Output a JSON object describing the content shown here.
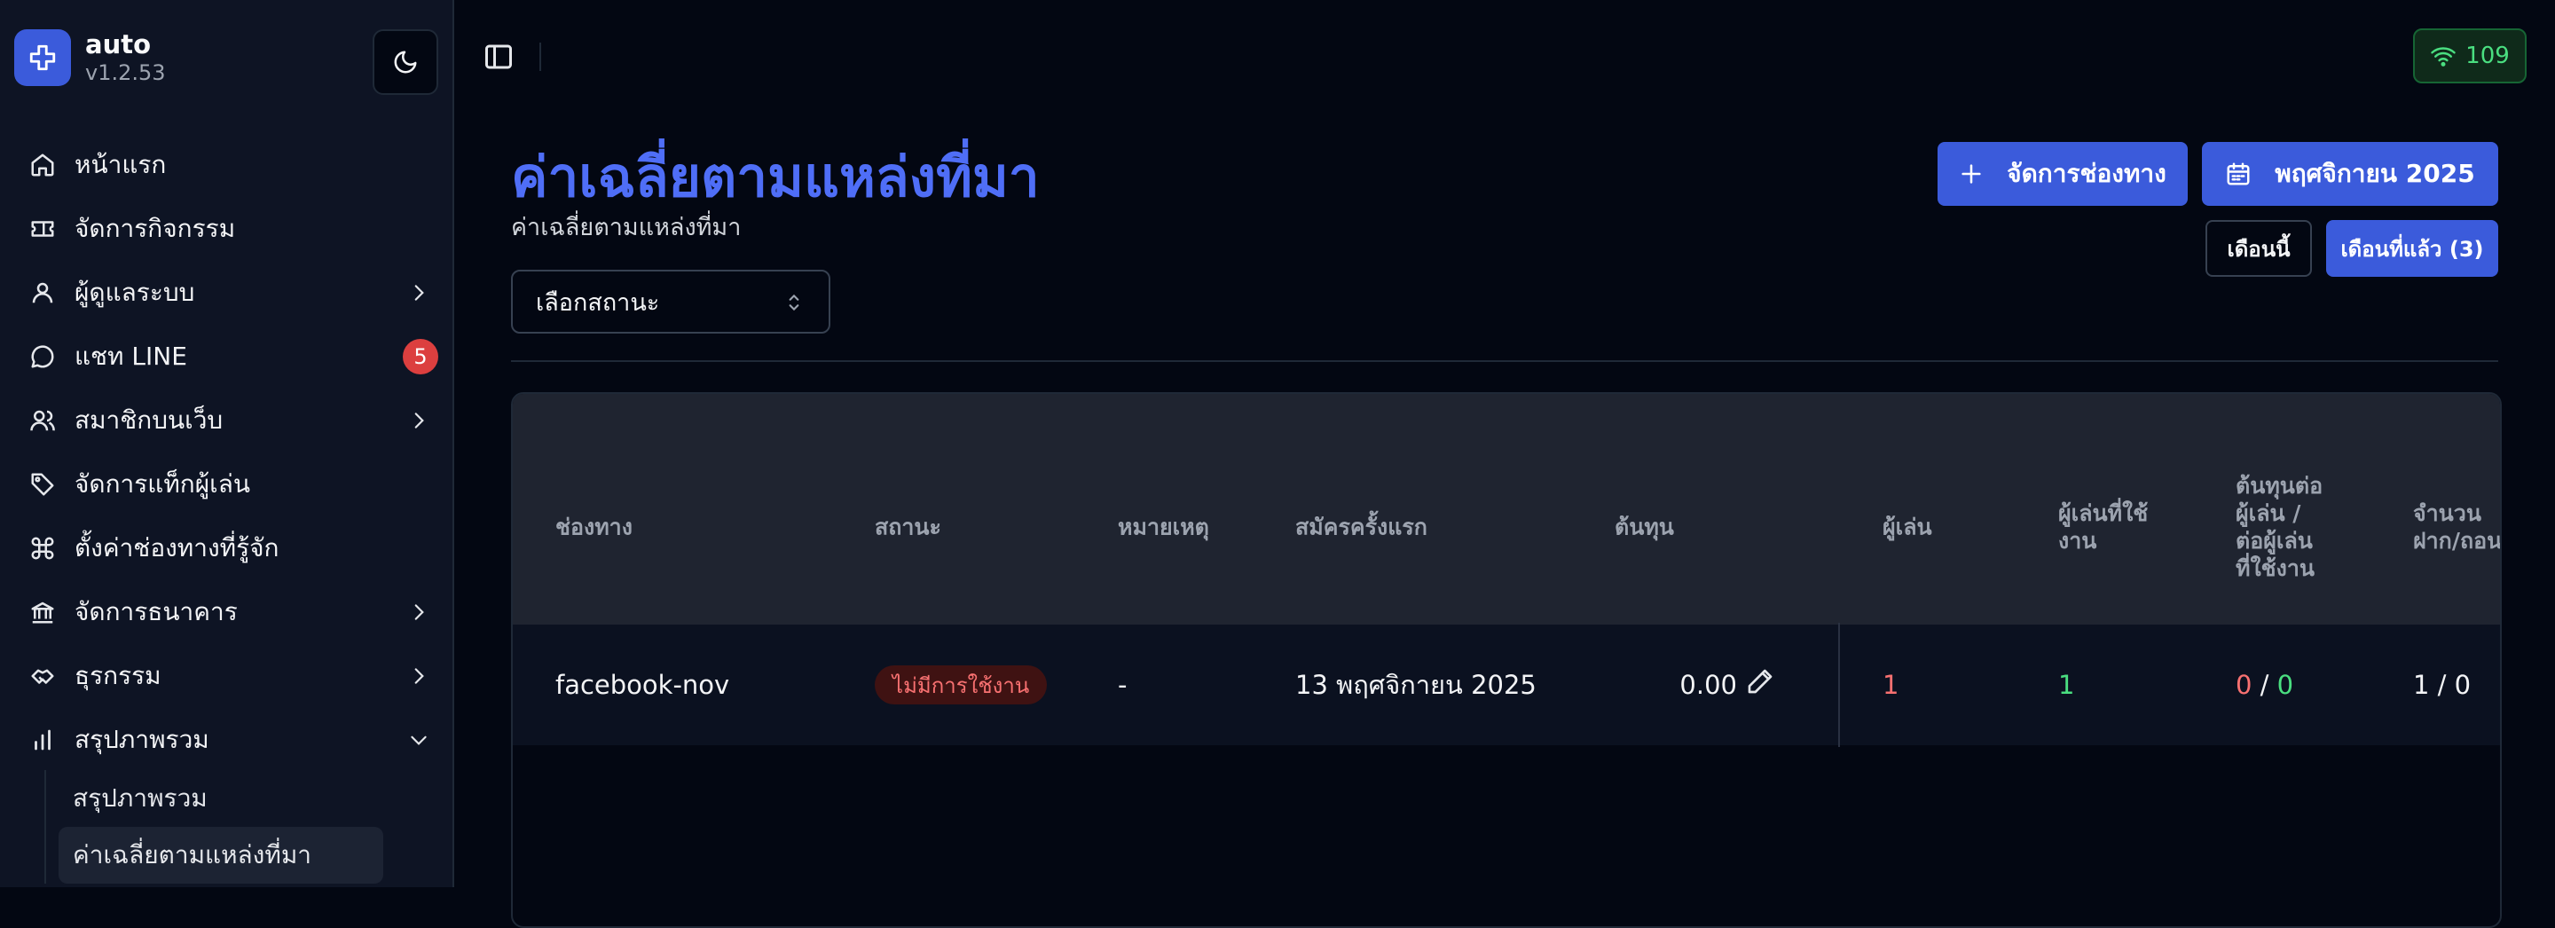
{
  "app": {
    "name": "auto",
    "version": "v1.2.53"
  },
  "sidebar": {
    "items": [
      {
        "label": "หน้าแรก"
      },
      {
        "label": "จัดการกิจกรรม"
      },
      {
        "label": "ผู้ดูแลระบบ"
      },
      {
        "label": "แชท LINE",
        "badge": "5"
      },
      {
        "label": "สมาชิกบนเว็บ"
      },
      {
        "label": "จัดการแท็กผู้เล่น"
      },
      {
        "label": "ตั้งค่าช่องทางที่รู้จัก"
      },
      {
        "label": "จัดการธนาคาร"
      },
      {
        "label": "ธุรกรรม"
      },
      {
        "label": "สรุปภาพรวม"
      }
    ],
    "subitems": [
      {
        "label": "สรุปภาพรวม"
      },
      {
        "label": "ค่าเฉลี่ยตามแหล่งที่มา"
      }
    ]
  },
  "topbar": {
    "signal_count": "109"
  },
  "page": {
    "title": "ค่าเฉลี่ยตามแหล่งที่มา",
    "subtitle": "ค่าเฉลี่ยตามแหล่งที่มา",
    "status_select": "เลือกสถานะ",
    "manage_button": "จัดการช่องทาง",
    "month_button": "พฤศจิกายน 2025",
    "this_month_button": "เดือนนี้",
    "last_month_button": "เดือนที่แล้ว (3)"
  },
  "table": {
    "headers": {
      "channel": "ช่องทาง",
      "status": "สถานะ",
      "note": "หมายเหตุ",
      "first_signup": "สมัครครั้งแรก",
      "cost": "ต้นทุน",
      "players": "ผู้เล่น",
      "active_1": "ผู้เล่นที่ใช้",
      "active_2": "งาน",
      "cpp_1": "ต้นทุนต่อ",
      "cpp_2": "ผู้เล่น /",
      "cpp_3": "ต่อผู้เล่น",
      "cpp_4": "ที่ใช้งาน",
      "dw_1": "จำนวน",
      "dw_2": "ฝาก/ถอน"
    },
    "rows": [
      {
        "channel": "facebook-nov",
        "status": "ไม่มีการใช้งาน",
        "note": "-",
        "first_signup": "13 พฤศจิกายน 2025",
        "cost": "0.00",
        "players": "1",
        "active": "1",
        "cpp_left": "0",
        "cpp_sep": " / ",
        "cpp_right": "0",
        "dw": "1 / 0"
      }
    ]
  },
  "colors": {
    "accent": "#3b5bdb",
    "title": "#4f6ef7",
    "danger": "#f87171",
    "success": "#4ade80"
  }
}
